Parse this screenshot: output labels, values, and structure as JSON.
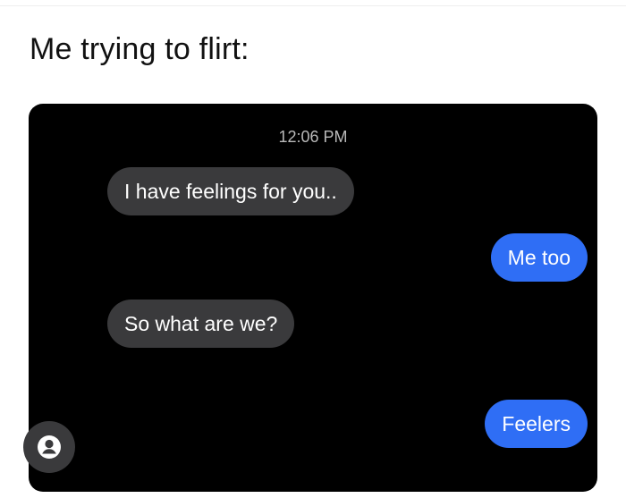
{
  "caption": "Me trying to flirt:",
  "chat": {
    "timestamp": "12:06 PM",
    "messages": [
      {
        "side": "received",
        "text": "I have feelings for you.."
      },
      {
        "side": "sent",
        "text": "Me too"
      },
      {
        "side": "received",
        "text": "So what are we?"
      },
      {
        "side": "sent",
        "text": "Feelers"
      }
    ]
  },
  "colors": {
    "received_bubble": "#3a3a3c",
    "sent_bubble": "#2f6ef5",
    "chat_background": "#000000"
  },
  "icons": {
    "profile": "user-icon"
  }
}
